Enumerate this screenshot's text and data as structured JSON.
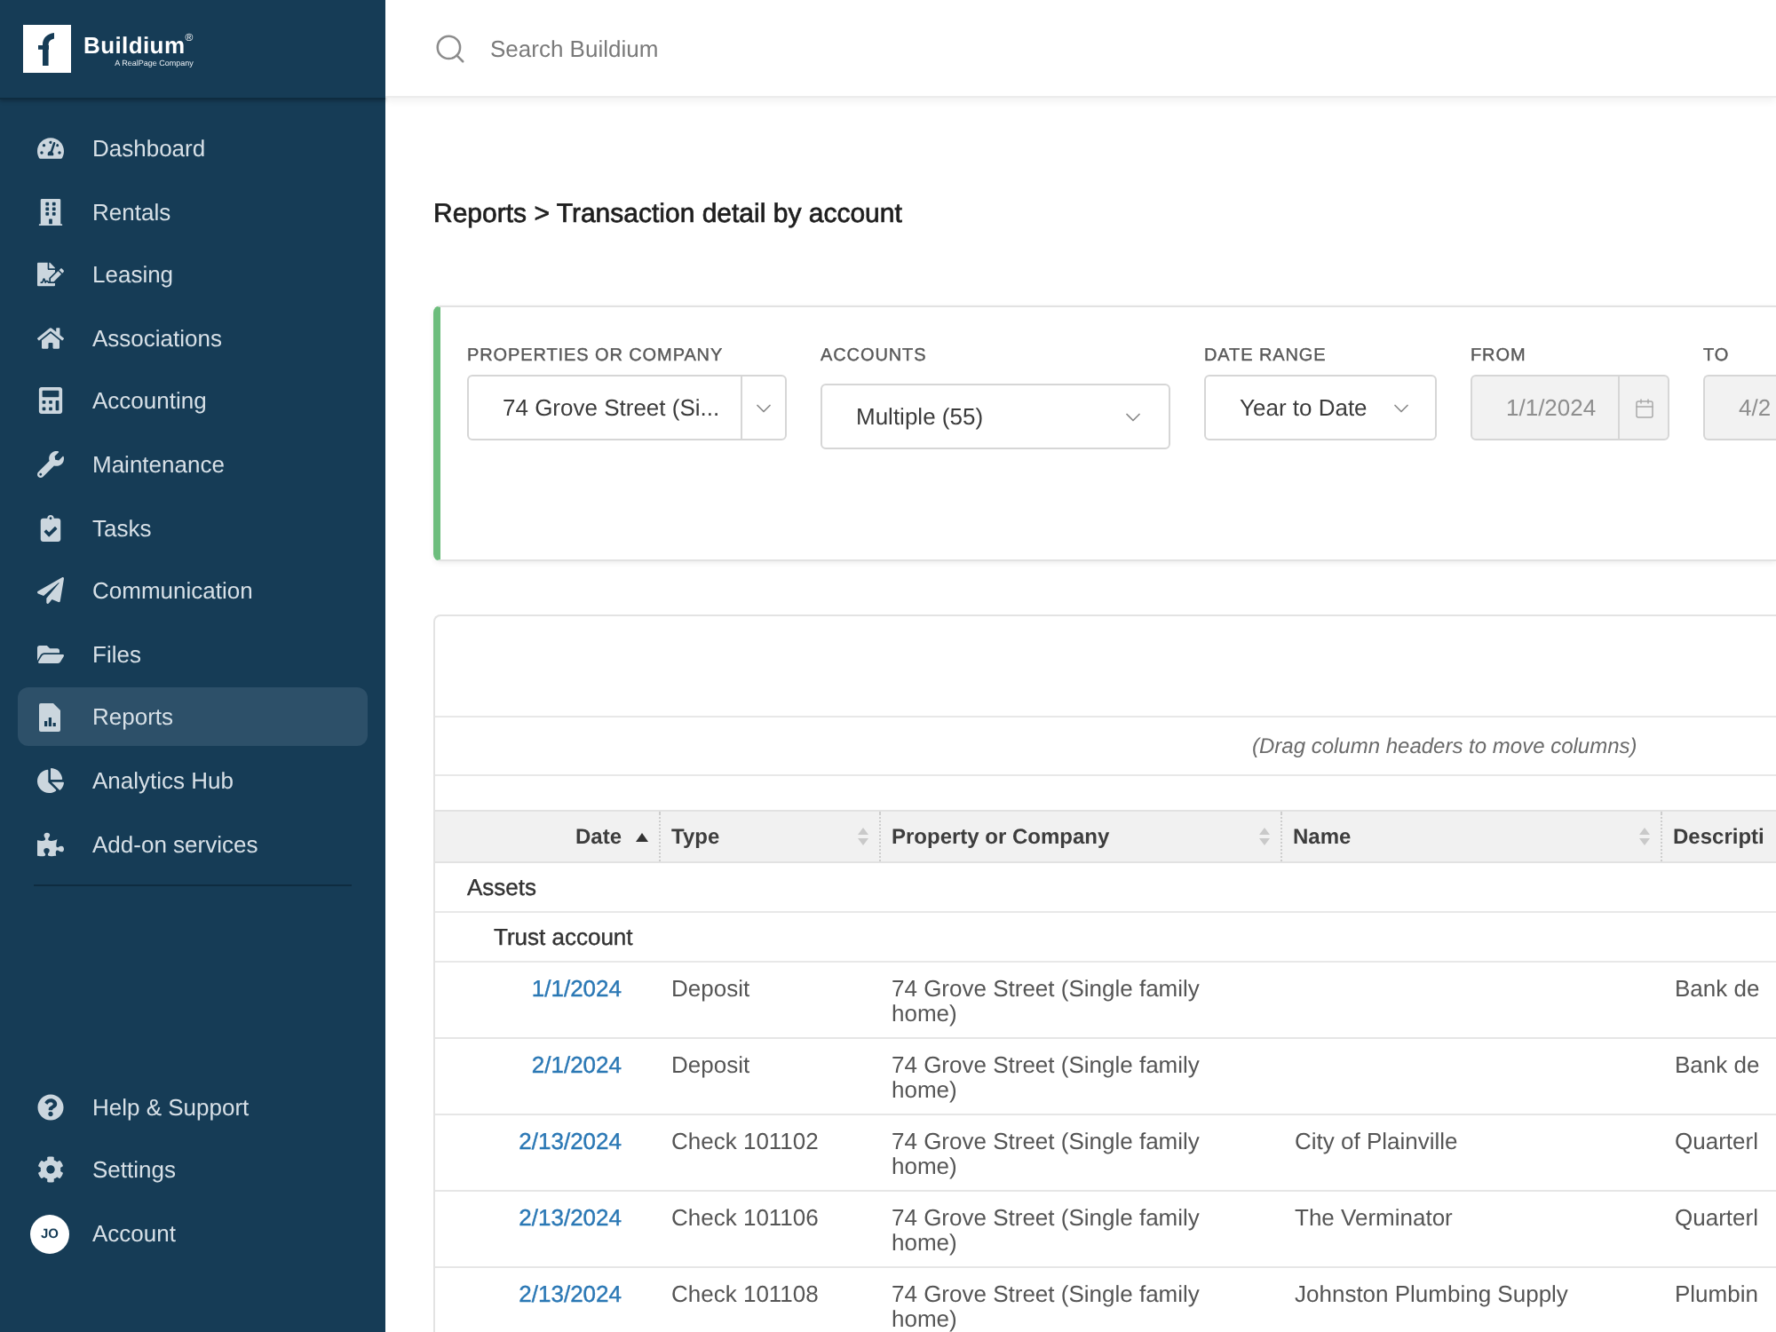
{
  "sidebar": {
    "brand": {
      "name": "Buildium$^{®}$",
      "tagline": "A RealPage Company"
    },
    "nav": [
      {
        "label": "Dashboard",
        "selected": false
      },
      {
        "label": "Rentals",
        "selected": false
      },
      {
        "label": "Leasing",
        "selected": false
      },
      {
        "label": "Associations",
        "selected": false
      },
      {
        "label": "Accounting",
        "selected": false
      },
      {
        "label": "Maintenance",
        "selected": false
      },
      {
        "label": "Tasks",
        "selected": false
      },
      {
        "label": "Communication",
        "selected": false
      },
      {
        "label": "Files",
        "selected": false
      },
      {
        "label": "Reports",
        "selected": true
      },
      {
        "label": "Analytics Hub",
        "selected": false
      },
      {
        "label": "Add-on services",
        "selected": false
      }
    ],
    "footer_nav": [
      {
        "label": "Help & Support",
        "selected": false
      },
      {
        "label": "Settings",
        "selected": false
      },
      {
        "label": "Account",
        "initials": "JO",
        "selected": false
      }
    ]
  },
  "search": {
    "placeholder": "Search Buildium"
  },
  "breadcrumb": "Reports > Transaction detail by account",
  "filters": [
    {
      "label": "PROPERTIES OR COMPANY",
      "value": "74 Grove Street (Si...",
      "kind": "split-select",
      "disabled": false
    },
    {
      "label": "ACCOUNTS",
      "value": "Multiple (55)",
      "kind": "multiselect",
      "disabled": false
    },
    {
      "label": "DATE RANGE",
      "value": "Year to Date",
      "kind": "select",
      "disabled": false
    },
    {
      "label": "FROM",
      "value": "1/1/2024",
      "kind": "date",
      "disabled": true
    },
    {
      "label": "TO",
      "value": "4/2",
      "kind": "date",
      "disabled": true
    }
  ],
  "report": {
    "hint": "(Drag column headers to move columns)",
    "columns": [
      {
        "label": "Date",
        "sorted": true
      },
      {
        "label": "Type",
        "sorted": false
      },
      {
        "label": "Property or Company",
        "sorted": false
      },
      {
        "label": "Name",
        "sorted": false
      },
      {
        "label": "Descripti"
      }
    ],
    "rows": [
      {
        "kind": "group",
        "label": "Assets",
        "children": [
          {
            "kind": "group",
            "label": "Trust account",
            "children": [
              {
                "kind": "entry",
                "date": "1/1/2024",
                "type": "Deposit",
                "property": "74 Grove Street (Single family home)",
                "column_5": "Bank de"
              },
              {
                "kind": "entry",
                "date": "2/1/2024",
                "type": "Deposit",
                "property": "74 Grove Street (Single family home)",
                "column_5": "Bank de"
              },
              {
                "kind": "entry",
                "date": "2/13/2024",
                "type": "Check 101102",
                "property": "74 Grove Street (Single family home)",
                "name": "City of Plainville",
                "column_5": "Quarterl"
              },
              {
                "kind": "entry",
                "date": "2/13/2024",
                "type": "Check 101106",
                "property": "74 Grove Street (Single family home)",
                "name": "The Verminator",
                "column_5": "Quarterl"
              },
              {
                "kind": "entry",
                "date": "2/13/2024",
                "type": "Check 101108",
                "property": "74 Grove Street (Single family home)",
                "name": "Johnston Plumbing Supply",
                "column_5": "Plumbin"
              }
            ]
          }
        ]
      }
    ]
  }
}
